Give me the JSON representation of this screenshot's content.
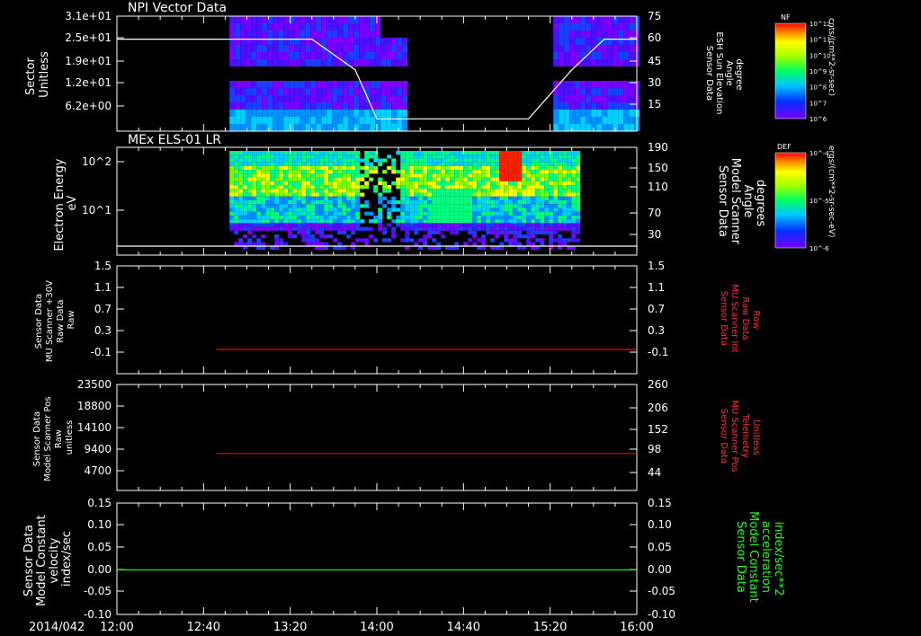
{
  "colors": {
    "background": "#000000",
    "axes": "#ffffff",
    "red_trace": "#ff0000",
    "green_trace": "#00ff00",
    "white_trace": "#ffffff"
  },
  "time_axis": {
    "date_label": "2014/042",
    "ticks": [
      "12:00",
      "12:40",
      "13:20",
      "14:00",
      "14:40",
      "15:20",
      "16:00"
    ],
    "range": [
      "12:00",
      "16:00"
    ]
  },
  "chart_data": [
    {
      "type": "heatmap",
      "title": "NPI Vector Data",
      "ylabel": [
        "Sector",
        "Unitless"
      ],
      "yticks": [
        "3.1e+01",
        "2.5e+01",
        "1.9e+01",
        "1.2e+01",
        "6.2e+00"
      ],
      "y2label": [
        "Sensor Data",
        "ESH Sun Elevation",
        "Angle",
        "degree"
      ],
      "y2ticks": [
        "75",
        "60",
        "45",
        "30",
        "15"
      ],
      "y2lim": [
        0,
        75
      ],
      "data_interval": [
        "12:52",
        "16:00"
      ],
      "gap_interval": [
        "14:14",
        "15:20"
      ],
      "overlay_line": {
        "name": "ESH Sun Elevation Angle",
        "color": "#ffffff",
        "points": [
          [
            "12:00",
            60
          ],
          [
            "13:30",
            60
          ],
          [
            "13:50",
            40
          ],
          [
            "14:00",
            8
          ],
          [
            "15:10",
            8
          ],
          [
            "15:30",
            40
          ],
          [
            "15:45",
            60
          ],
          [
            "16:00",
            60
          ]
        ]
      },
      "colorbar": {
        "label": "NF",
        "units": "cnts/(cm**2-sr-sec)",
        "ticks": [
          "10^12",
          "10^11",
          "10^10",
          "10^9",
          "10^8",
          "10^7",
          "10^6"
        ]
      }
    },
    {
      "type": "heatmap",
      "title": "MEx ELS-01 LR",
      "ylabel": [
        "Electron Energy",
        "eV"
      ],
      "yscale": "log",
      "yticks": [
        "10^2",
        "10^1"
      ],
      "y2label": [
        "Sensor Data",
        "Model Scanner",
        "Angle",
        "degrees"
      ],
      "y2ticks": [
        "190",
        "150",
        "110",
        "70",
        "30"
      ],
      "y2lim": [
        0,
        190
      ],
      "data_interval": [
        "12:52",
        "15:32"
      ],
      "overlay_line": {
        "name": "Model Scanner Angle",
        "color": "#ffffff",
        "points": [
          [
            "12:00",
            10
          ],
          [
            "16:00",
            10
          ]
        ]
      },
      "colorbar": {
        "label": "DEF",
        "units": "ergs/(cm**2-sr-sec-eV)",
        "ticks": [
          "10^-4",
          "10^-5",
          "10^-6"
        ]
      }
    },
    {
      "type": "line",
      "ylabel": [
        "Sensor Data",
        "MU Scanner +30V",
        "Raw Data",
        "Raw"
      ],
      "yticks": [
        "1.5",
        "1.1",
        "0.7",
        "0.3",
        "-0.1"
      ],
      "ylim": [
        -0.5,
        1.5
      ],
      "y2label": [
        "Sensor Data",
        "MU Scanner Int",
        "Raw Data",
        "Raw"
      ],
      "y2ticks": [
        "1.5",
        "1.1",
        "0.7",
        "0.3",
        "-0.1"
      ],
      "series": [
        {
          "color": "#ff0000",
          "x": [
            "12:46",
            "16:00"
          ],
          "values": [
            -0.05,
            -0.05
          ]
        }
      ]
    },
    {
      "type": "line",
      "ylabel": [
        "Sensor Data",
        "Model Scanner Pos",
        "Raw",
        "unitless"
      ],
      "yticks": [
        "23500",
        "18800",
        "14100",
        "9400",
        "4700"
      ],
      "ylim": [
        0,
        23500
      ],
      "y2label": [
        "Sensor Data",
        "MU Scanner Pos",
        "Telemetry",
        "Unitless"
      ],
      "y2ticks": [
        "260",
        "206",
        "152",
        "98",
        "44"
      ],
      "series": [
        {
          "color": "#ff0000",
          "x": [
            "12:46",
            "16:00"
          ],
          "values": [
            8200,
            8200
          ]
        }
      ]
    },
    {
      "type": "line",
      "ylabel": [
        "Sensor Data",
        "Model Constant",
        "velocity",
        "index/sec"
      ],
      "yticks": [
        "0.15",
        "0.10",
        "0.05",
        "0.00",
        "-0.05",
        "-0.10"
      ],
      "ylim": [
        -0.1,
        0.15
      ],
      "y2label": [
        "Sensor Data",
        "Model Constant",
        "acceleration",
        "index/sec**2"
      ],
      "y2ticks": [
        "0.15",
        "0.10",
        "0.05",
        "0.00",
        "-0.05",
        "-0.10"
      ],
      "series": [
        {
          "color": "#00ff00",
          "x": [
            "12:00",
            "16:00"
          ],
          "values": [
            0.0,
            0.0
          ]
        }
      ]
    }
  ]
}
